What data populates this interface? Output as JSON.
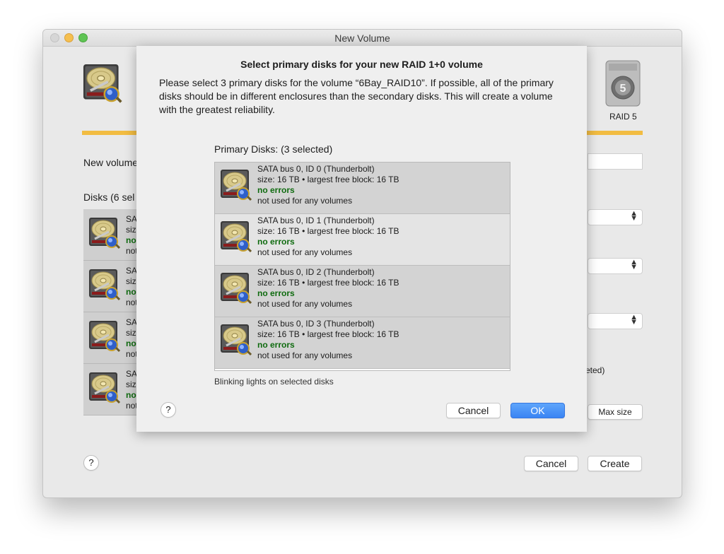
{
  "window": {
    "title": "New Volume"
  },
  "background": {
    "new_volume_label": "New volume",
    "disks_label": "Disks (6 sel",
    "disk_rows": [
      {
        "l1": "SA",
        "l2": "siz",
        "l3": "no",
        "l4": "not"
      },
      {
        "l1": "SA",
        "l2": "siz",
        "l3": "no",
        "l4": "not"
      },
      {
        "l1": "SA",
        "l2": "siz",
        "l3": "no",
        "l4": "not"
      },
      {
        "l1": "SA",
        "l2": "siz",
        "l3": "no",
        "l4": "not"
      }
    ],
    "raid_label": "RAID 5",
    "deleted_fragment": "eted)",
    "max_size_button": "Max size",
    "help_button": "?",
    "cancel_button": "Cancel",
    "create_button": "Create"
  },
  "dialog": {
    "title": "Select primary disks for your new RAID 1+0 volume",
    "message": "Please select 3 primary disks for the volume “6Bay_RAID10”.  If possible, all of the primary disks should be in different enclosures than the secondary disks.  This will create a volume with the greatest reliability.",
    "list_label": "Primary Disks: (3 selected)",
    "disks": [
      {
        "name": "SATA bus 0, ID 0 (Thunderbolt)",
        "size": "size: 16 TB • largest free block: 16 TB",
        "status": "no errors",
        "usage": "not used for any volumes",
        "selected": true
      },
      {
        "name": "SATA bus 0, ID 1 (Thunderbolt)",
        "size": "size: 16 TB • largest free block: 16 TB",
        "status": "no errors",
        "usage": "not used for any volumes",
        "selected": false
      },
      {
        "name": "SATA bus 0, ID 2 (Thunderbolt)",
        "size": "size: 16 TB • largest free block: 16 TB",
        "status": "no errors",
        "usage": "not used for any volumes",
        "selected": true
      },
      {
        "name": "SATA bus 0, ID 3 (Thunderbolt)",
        "size": "size: 16 TB • largest free block: 16 TB",
        "status": "no errors",
        "usage": "not used for any volumes",
        "selected": true
      }
    ],
    "blinking_note": "Blinking lights on selected disks",
    "help_button": "?",
    "cancel_button": "Cancel",
    "ok_button": "OK"
  },
  "colors": {
    "accent": "#3a84f3",
    "gold_bar": "#f2bc42",
    "ok_text": "#0f6b0f"
  }
}
